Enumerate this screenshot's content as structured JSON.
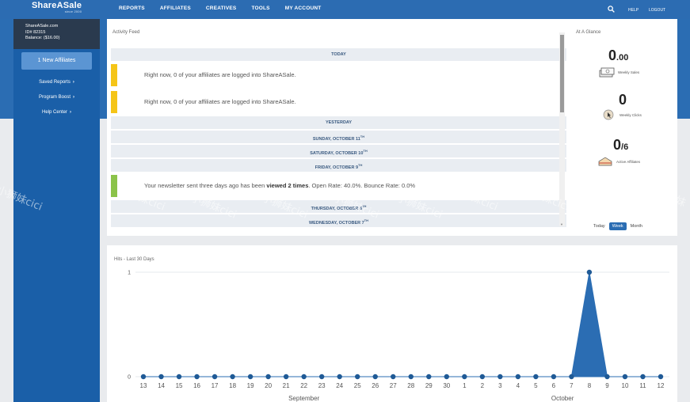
{
  "header": {
    "logo": "ShareASale",
    "logo_sub": "since 2000",
    "nav": [
      "REPORTS",
      "AFFILIATES",
      "CREATIVES",
      "TOOLS",
      "MY ACCOUNT"
    ],
    "help": "HELP",
    "logout": "LOGOUT"
  },
  "account": {
    "name": "ShareASale.com",
    "id": "ID# 82315",
    "balance": "Balance: ($16.00)"
  },
  "sidebar": {
    "new_affiliates": "1 New Affiliates",
    "links": [
      "Saved Reports",
      "Program Boost",
      "Help Center"
    ]
  },
  "activity": {
    "title": "Activity Feed",
    "today": "TODAY",
    "item1": "Right now, 0 of your affiliates are logged into ShareASale.",
    "item2": "Right now, 0 of your affiliates are logged into ShareASale.",
    "yesterday": "YESTERDAY",
    "d1": "SUNDAY, OCTOBER 11",
    "d2": "SATURDAY, OCTOBER 10",
    "d3": "FRIDAY, OCTOBER 9",
    "th": "TH",
    "news_pre": "Your newsletter sent three days ago has been ",
    "news_bold": "viewed 2 times",
    "news_post": ". Open Rate: 40.0%. Bounce Rate: 0.0%",
    "d4": "THURSDAY, OCTOBER 8",
    "d5": "WEDNESDAY, OCTOBER 7",
    "bar_yellow": "#f5c518",
    "bar_green": "#8bc34a"
  },
  "glance": {
    "title": "At A Glance",
    "sales_num": "0",
    "sales_dec": ".00",
    "sales_lbl": "Weekly Sales",
    "clicks_num": "0",
    "clicks_lbl": "Weekly Clicks",
    "aff_num": "0",
    "aff_den": "/6",
    "aff_lbl": "Active Affiliates",
    "periods": [
      "Today",
      "Week",
      "Month"
    ]
  },
  "chart_data": {
    "type": "area",
    "title": "Hits - Last 30 Days",
    "x": [
      "13",
      "14",
      "15",
      "16",
      "17",
      "18",
      "19",
      "20",
      "21",
      "22",
      "23",
      "24",
      "25",
      "26",
      "27",
      "28",
      "29",
      "30",
      "1",
      "2",
      "3",
      "4",
      "5",
      "6",
      "7",
      "8",
      "9",
      "10",
      "11",
      "12"
    ],
    "values": [
      0,
      0,
      0,
      0,
      0,
      0,
      0,
      0,
      0,
      0,
      0,
      0,
      0,
      0,
      0,
      0,
      0,
      0,
      0,
      0,
      0,
      0,
      0,
      0,
      0,
      1,
      0,
      0,
      0,
      0
    ],
    "month_labels": [
      "September",
      "October"
    ],
    "ylim": [
      0,
      1
    ],
    "yticks": [
      "0",
      "1"
    ],
    "color": "#2b6db3"
  },
  "watermark": "小狮妹cici"
}
